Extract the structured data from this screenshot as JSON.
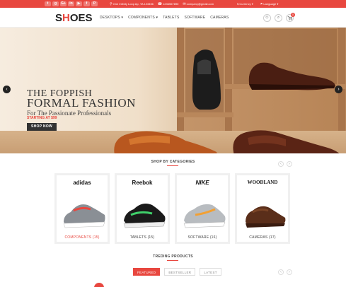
{
  "topbar": {
    "social": [
      "t",
      "g",
      "G+",
      "in",
      "▶",
      "f",
      "P"
    ],
    "address": "One Infinity Loop Ap, TA 123456",
    "phone": "1234567890",
    "email": "company@gmail.com",
    "currency": "Currency",
    "language": "Language",
    "color": "#e8473f"
  },
  "header": {
    "logo_s": "S",
    "logo_h": "H",
    "logo_rest": "OES",
    "nav": [
      "DESKTOPS",
      "COMPONENTS",
      "TABLETS",
      "SOFTWARE",
      "CAMERAS"
    ]
  },
  "hero": {
    "title_line1": "THE FOPPISH",
    "title_line2": "FORMAL FASHION",
    "subtitle": "For The Passionate Professionals",
    "price": "STARTING AT $99",
    "button": "SHOP NOW"
  },
  "categories": {
    "title": "SHOP BY CATEGORIES",
    "items": [
      {
        "brand": "adidas",
        "label": "COMPONENTS (15)",
        "active": true
      },
      {
        "brand": "Reebok",
        "label": "TABLETS (15)",
        "active": false
      },
      {
        "brand": "NIKE",
        "label": "SOFTWARE (16)",
        "active": false
      },
      {
        "brand": "WOODLAND",
        "label": "CAMERAS (17)",
        "active": false
      }
    ]
  },
  "trending": {
    "title": "TREDING PRODUCTS",
    "tabs": [
      "FEATURED",
      "BESTSELLER",
      "LATEST"
    ]
  },
  "icons": {
    "prev": "‹",
    "next": "›",
    "user": "☺",
    "search": "⌕",
    "cart": "🛒"
  },
  "cart_count": "0"
}
